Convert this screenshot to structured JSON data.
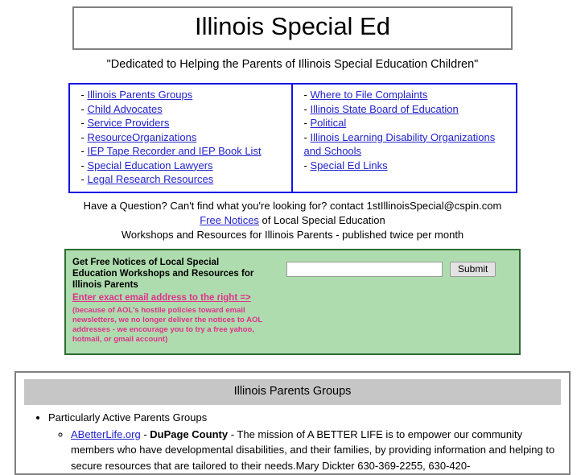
{
  "header": {
    "title": "Illinois Special Ed",
    "tagline": "\"Dedicated to Helping the Parents of Illinois Special Education Children\""
  },
  "nav": {
    "dash": "-",
    "left_links": [
      "Illinois Parents Groups",
      "Child Advocates",
      "Service Providers",
      "ResourceOrganizations",
      "IEP Tape Recorder and IEP Book List",
      "Special Education Lawyers",
      "Legal Research Resources"
    ],
    "right_links": [
      "Where to File Complaints",
      "Illinois State Board of Education",
      "Political",
      "Illinois Learning Disability Organizations and Schools",
      "Special Ed Links"
    ]
  },
  "contact": {
    "line1": "Have a Question? Can't find what you're looking for? contact 1stIllinoisSpecial@cspin.com",
    "line2_link": "Free Notices",
    "line2_rest": " of Local Special Education",
    "line3": "Workshops and Resources for Illinois Parents - published twice per month"
  },
  "signup": {
    "heading": "Get Free Notices of Local Special Education Workshops and Resources for Illinois Parents",
    "cta": "Enter exact email address to the right =>",
    "note": "(because of AOL's hostile policies toward email newsletters, we no longer deliver the notices to AOL addresses - we encourage you to try a free yahoo, hotmail, or gmail account)",
    "email_value": "",
    "email_placeholder": "",
    "submit_label": "Submit",
    "accent_color": "#e0318c",
    "box_bg": "#aedcae",
    "box_border": "#2d6b33"
  },
  "section": {
    "heading": "Illinois Parents Groups",
    "bullet1": "Particularly Active Parents Groups",
    "entry": {
      "link": "ABetterLife.org",
      "sep1": " - ",
      "county": "DuPage County",
      "body": " - The mission of A BETTER LIFE is to empower our community members who have developmental disabilities, and their families, by providing information and helping to secure resources that are tailored to their needs.Mary Dickter 630-369-2255, 630-420-"
    }
  },
  "colors": {
    "link_blue": "#2222cc",
    "box_blue": "#1414e6",
    "frame_gray": "#808080",
    "head_gray": "#c6c6c6"
  }
}
